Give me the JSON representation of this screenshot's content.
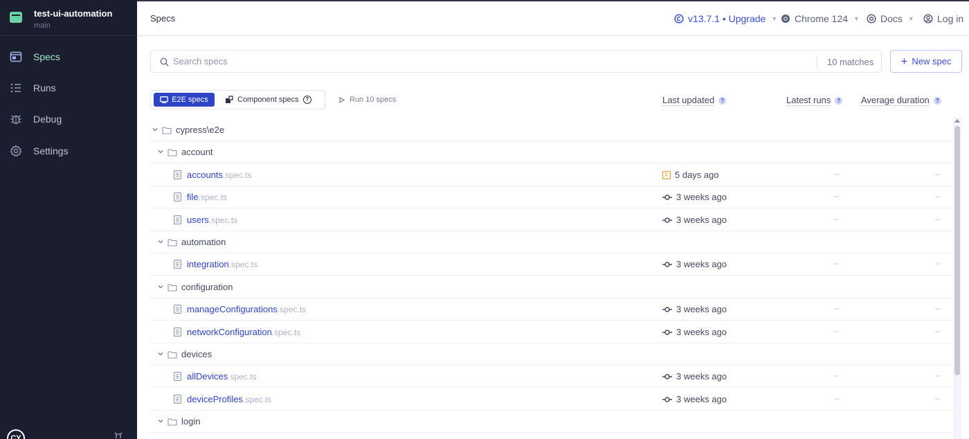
{
  "project": {
    "name": "test-ui-automation",
    "branch": "main",
    "logo_text": "CY"
  },
  "sidebar": {
    "items": [
      {
        "label": "Specs",
        "icon": "specs-icon",
        "active": true
      },
      {
        "label": "Runs",
        "icon": "runs-icon",
        "active": false
      },
      {
        "label": "Debug",
        "icon": "bug-icon",
        "active": false
      },
      {
        "label": "Settings",
        "icon": "gear-icon",
        "active": false
      }
    ]
  },
  "header": {
    "breadcrumb": "Specs",
    "version": "v13.7.1 • Upgrade",
    "browser": "Chrome 124",
    "docs": "Docs",
    "login": "Log in"
  },
  "search": {
    "placeholder": "Search specs",
    "value": "",
    "matches": "10 matches"
  },
  "new_spec_label": "New spec",
  "tabs": {
    "e2e": "E2E specs",
    "component": "Component specs",
    "active": "e2e"
  },
  "run_label": "Run 10 specs",
  "columns": {
    "last_updated": "Last updated",
    "latest_runs": "Latest runs",
    "average_duration": "Average duration"
  },
  "tree": [
    {
      "type": "dir",
      "name": "cypress\\e2e",
      "depth": 0
    },
    {
      "type": "dir",
      "name": "account",
      "depth": 1
    },
    {
      "type": "file",
      "base": "accounts",
      "ext": ".spec.ts",
      "updated": "5 days ago",
      "status": "pending",
      "runs": "--",
      "duration": "--"
    },
    {
      "type": "file",
      "base": "file",
      "ext": ".spec.ts",
      "updated": "3 weeks ago",
      "status": "committed",
      "runs": "--",
      "duration": "--"
    },
    {
      "type": "file",
      "base": "users",
      "ext": ".spec.ts",
      "updated": "3 weeks ago",
      "status": "committed",
      "runs": "--",
      "duration": "--"
    },
    {
      "type": "dir",
      "name": "automation",
      "depth": 1
    },
    {
      "type": "file",
      "base": "integration",
      "ext": ".spec.ts",
      "updated": "3 weeks ago",
      "status": "committed",
      "runs": "--",
      "duration": "--"
    },
    {
      "type": "dir",
      "name": "configuration",
      "depth": 1
    },
    {
      "type": "file",
      "base": "manageConfigurations",
      "ext": ".spec.ts",
      "updated": "3 weeks ago",
      "status": "committed",
      "runs": "--",
      "duration": "--"
    },
    {
      "type": "file",
      "base": "networkConfiguration",
      "ext": ".spec.ts",
      "updated": "3 weeks ago",
      "status": "committed",
      "runs": "--",
      "duration": "--"
    },
    {
      "type": "dir",
      "name": "devices",
      "depth": 1
    },
    {
      "type": "file",
      "base": "allDevices",
      "ext": ".spec.ts",
      "updated": "3 weeks ago",
      "status": "committed",
      "runs": "--",
      "duration": "--"
    },
    {
      "type": "file",
      "base": "deviceProfiles",
      "ext": ".spec.ts",
      "updated": "3 weeks ago",
      "status": "committed",
      "runs": "--",
      "duration": "--"
    },
    {
      "type": "dir",
      "name": "login",
      "depth": 1
    }
  ]
}
